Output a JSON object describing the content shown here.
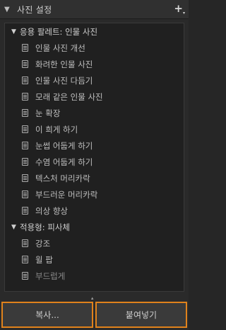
{
  "panel": {
    "title": "사진 설정",
    "collapse_glyph": "▼",
    "add_glyph": "+",
    "add_caret_glyph": "▾"
  },
  "groups": [
    {
      "label": "응용 팔레트: 인물 사진",
      "expanded": true,
      "items": [
        "인물 사진 개선",
        "화려한 인물 사진",
        "인물 사진 다듬기",
        "모래 같은 인물 사진",
        "눈 확장",
        "이 희게 하기",
        "눈썹 어둡게 하기",
        "수염 어둡게 하기",
        "텍스처 머리카락",
        "부드러운 머리카락",
        "의상 향상"
      ]
    },
    {
      "label": "적용형: 피사체",
      "expanded": true,
      "items": [
        "강조",
        "윌 팝",
        "부드럽게"
      ]
    }
  ],
  "buttons": {
    "copy": "복사...",
    "paste": "붙여넣기"
  },
  "colors": {
    "button_focus_border": "#e0821c",
    "panel_bg": "#2a2a2a",
    "list_bg": "#202020"
  },
  "icons": {
    "preset_item": "preset-document-icon",
    "group_toggle": "triangle-down-icon"
  }
}
